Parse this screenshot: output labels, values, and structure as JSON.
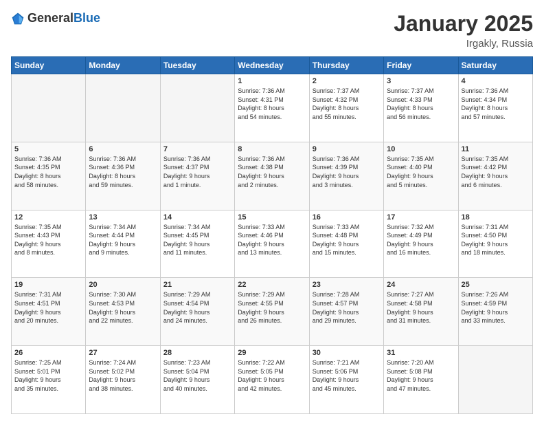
{
  "header": {
    "logo_general": "General",
    "logo_blue": "Blue",
    "month_year": "January 2025",
    "location": "Irgakly, Russia"
  },
  "weekdays": [
    "Sunday",
    "Monday",
    "Tuesday",
    "Wednesday",
    "Thursday",
    "Friday",
    "Saturday"
  ],
  "weeks": [
    [
      {
        "day": "",
        "info": ""
      },
      {
        "day": "",
        "info": ""
      },
      {
        "day": "",
        "info": ""
      },
      {
        "day": "1",
        "info": "Sunrise: 7:36 AM\nSunset: 4:31 PM\nDaylight: 8 hours\nand 54 minutes."
      },
      {
        "day": "2",
        "info": "Sunrise: 7:37 AM\nSunset: 4:32 PM\nDaylight: 8 hours\nand 55 minutes."
      },
      {
        "day": "3",
        "info": "Sunrise: 7:37 AM\nSunset: 4:33 PM\nDaylight: 8 hours\nand 56 minutes."
      },
      {
        "day": "4",
        "info": "Sunrise: 7:36 AM\nSunset: 4:34 PM\nDaylight: 8 hours\nand 57 minutes."
      }
    ],
    [
      {
        "day": "5",
        "info": "Sunrise: 7:36 AM\nSunset: 4:35 PM\nDaylight: 8 hours\nand 58 minutes."
      },
      {
        "day": "6",
        "info": "Sunrise: 7:36 AM\nSunset: 4:36 PM\nDaylight: 8 hours\nand 59 minutes."
      },
      {
        "day": "7",
        "info": "Sunrise: 7:36 AM\nSunset: 4:37 PM\nDaylight: 9 hours\nand 1 minute."
      },
      {
        "day": "8",
        "info": "Sunrise: 7:36 AM\nSunset: 4:38 PM\nDaylight: 9 hours\nand 2 minutes."
      },
      {
        "day": "9",
        "info": "Sunrise: 7:36 AM\nSunset: 4:39 PM\nDaylight: 9 hours\nand 3 minutes."
      },
      {
        "day": "10",
        "info": "Sunrise: 7:35 AM\nSunset: 4:40 PM\nDaylight: 9 hours\nand 5 minutes."
      },
      {
        "day": "11",
        "info": "Sunrise: 7:35 AM\nSunset: 4:42 PM\nDaylight: 9 hours\nand 6 minutes."
      }
    ],
    [
      {
        "day": "12",
        "info": "Sunrise: 7:35 AM\nSunset: 4:43 PM\nDaylight: 9 hours\nand 8 minutes."
      },
      {
        "day": "13",
        "info": "Sunrise: 7:34 AM\nSunset: 4:44 PM\nDaylight: 9 hours\nand 9 minutes."
      },
      {
        "day": "14",
        "info": "Sunrise: 7:34 AM\nSunset: 4:45 PM\nDaylight: 9 hours\nand 11 minutes."
      },
      {
        "day": "15",
        "info": "Sunrise: 7:33 AM\nSunset: 4:46 PM\nDaylight: 9 hours\nand 13 minutes."
      },
      {
        "day": "16",
        "info": "Sunrise: 7:33 AM\nSunset: 4:48 PM\nDaylight: 9 hours\nand 15 minutes."
      },
      {
        "day": "17",
        "info": "Sunrise: 7:32 AM\nSunset: 4:49 PM\nDaylight: 9 hours\nand 16 minutes."
      },
      {
        "day": "18",
        "info": "Sunrise: 7:31 AM\nSunset: 4:50 PM\nDaylight: 9 hours\nand 18 minutes."
      }
    ],
    [
      {
        "day": "19",
        "info": "Sunrise: 7:31 AM\nSunset: 4:51 PM\nDaylight: 9 hours\nand 20 minutes."
      },
      {
        "day": "20",
        "info": "Sunrise: 7:30 AM\nSunset: 4:53 PM\nDaylight: 9 hours\nand 22 minutes."
      },
      {
        "day": "21",
        "info": "Sunrise: 7:29 AM\nSunset: 4:54 PM\nDaylight: 9 hours\nand 24 minutes."
      },
      {
        "day": "22",
        "info": "Sunrise: 7:29 AM\nSunset: 4:55 PM\nDaylight: 9 hours\nand 26 minutes."
      },
      {
        "day": "23",
        "info": "Sunrise: 7:28 AM\nSunset: 4:57 PM\nDaylight: 9 hours\nand 29 minutes."
      },
      {
        "day": "24",
        "info": "Sunrise: 7:27 AM\nSunset: 4:58 PM\nDaylight: 9 hours\nand 31 minutes."
      },
      {
        "day": "25",
        "info": "Sunrise: 7:26 AM\nSunset: 4:59 PM\nDaylight: 9 hours\nand 33 minutes."
      }
    ],
    [
      {
        "day": "26",
        "info": "Sunrise: 7:25 AM\nSunset: 5:01 PM\nDaylight: 9 hours\nand 35 minutes."
      },
      {
        "day": "27",
        "info": "Sunrise: 7:24 AM\nSunset: 5:02 PM\nDaylight: 9 hours\nand 38 minutes."
      },
      {
        "day": "28",
        "info": "Sunrise: 7:23 AM\nSunset: 5:04 PM\nDaylight: 9 hours\nand 40 minutes."
      },
      {
        "day": "29",
        "info": "Sunrise: 7:22 AM\nSunset: 5:05 PM\nDaylight: 9 hours\nand 42 minutes."
      },
      {
        "day": "30",
        "info": "Sunrise: 7:21 AM\nSunset: 5:06 PM\nDaylight: 9 hours\nand 45 minutes."
      },
      {
        "day": "31",
        "info": "Sunrise: 7:20 AM\nSunset: 5:08 PM\nDaylight: 9 hours\nand 47 minutes."
      },
      {
        "day": "",
        "info": ""
      }
    ]
  ]
}
